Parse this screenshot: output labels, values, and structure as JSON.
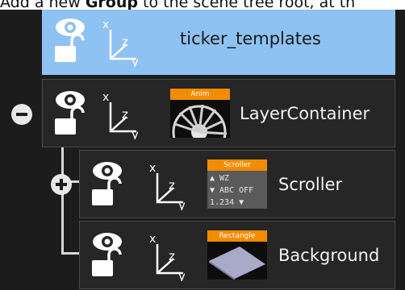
{
  "caption": {
    "before": "Add a new ",
    "bold": "Group",
    "after": " to the scene tree root, at th"
  },
  "tree": {
    "nodes": [
      {
        "name": "ticker_templates",
        "selected": true,
        "thumbnail": null,
        "expander": null
      },
      {
        "name": "LayerContainer",
        "selected": false,
        "thumbnail": {
          "tag": "Anim",
          "icon": "anim-wheel-icon"
        },
        "expander": "collapse"
      },
      {
        "name": "Scroller",
        "selected": false,
        "thumbnail": {
          "tag": "Scroller",
          "icon": "scroller-plugin-icon",
          "lines": [
            "▲ WZ",
            "▼ ABC  OFF",
            "1.234 ▼"
          ]
        },
        "expander": "expand"
      },
      {
        "name": "Background",
        "selected": false,
        "thumbnail": {
          "tag": "Rectangle",
          "icon": "rectangle-plane-icon"
        },
        "expander": null
      }
    ],
    "axis_labels": {
      "x": "x",
      "y": "y",
      "z": "z"
    }
  },
  "colors": {
    "selected_row": "#8ec2f2",
    "row_bg": "#262626",
    "tree_bg": "#1c1c1c",
    "tag_orange": "#f28c00"
  }
}
